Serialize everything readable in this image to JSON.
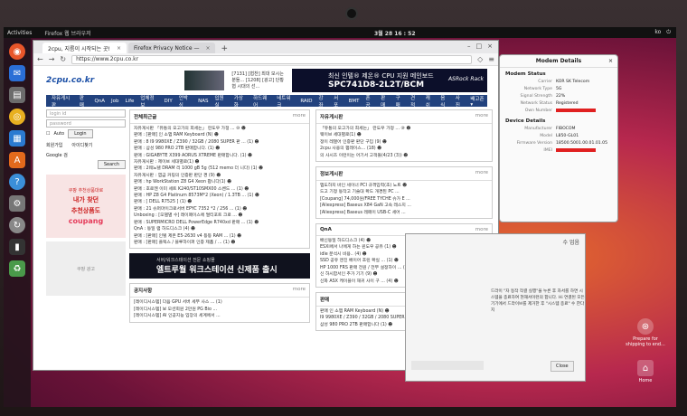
{
  "topbar": {
    "activities": "Activities",
    "app_menu": "Firefox 웹 브라우저",
    "clock": "3월 28 16 : 52",
    "tray": [
      "ko",
      "⏻"
    ]
  },
  "browser": {
    "tabs": [
      {
        "label": "2cpu, 지름이 시작되는 곳!"
      },
      {
        "label": "Firefox Privacy Notice —"
      }
    ],
    "new_tab": "+",
    "url": "https://www.2cpu.co.kr"
  },
  "site": {
    "logo": "2cpu.co.kr",
    "ad_text": "[7131] [협찬] 최대 모시는 분들... [1208] [광고] 단황협 시대의 선...",
    "ad2_line1": "최신 인텔® 제온® CPU 지원 메인보드",
    "ad2_line2": "SPC741D8-2L2T/BCM",
    "ad2_brand": "ASRock Rack",
    "menu": [
      "자유게시판",
      "판매",
      "QnA",
      "Job",
      "Life",
      "업체정보",
      "DIY",
      "언박싱",
      "NAS",
      "입원실",
      "가상화",
      "하드웨어",
      "네트워크",
      "RAID",
      "강좌",
      "서포",
      "BMT",
      "혼공",
      "판매",
      "구매",
      "견적",
      "캐쉬",
      "음식",
      "사진",
      "배고픈 ▾"
    ],
    "login_id": "login id",
    "password": "password",
    "auto": "Auto",
    "login_btn": "Login",
    "signup": "회원가입",
    "find_pw": "아이디찾기",
    "search_label": "Google 검",
    "search_btn": "Search",
    "side_ad_line1": "쿠팡 추천상품대로",
    "side_ad_line2": "내가 찾던",
    "side_ad_line3": "추천상품도",
    "side_ad_brand": "coupang",
    "side_ad2": "쿠팡 광고"
  },
  "sections": {
    "all_latest": {
      "title": "전체최근글",
      "more": "more",
      "items": [
        "자유게시판 「유통의 오고가의 희세는」 란도우 가정 ... ⑩ ☻",
        "판매 : [판매] 인 소앱 RAM Keyboard (N) ☻",
        "판매 : 8 I9 9980XE / Z390 / 32GB / 2080 SUPER 판 ... (1) ☻",
        "판매 : 삼성 980 PRO 2TB 판매합니다. (1) ☻",
        "판매 : GIGABYTE X399 AORUS XTREME 판매합니다. (1) ☻",
        "자유게시판 : 제이브 세대별로(1) ☻",
        "판매 : 2웨노텔 DRAM 리 1000 gB 5g (512 memo 더 니다) (1) ☻",
        "자유게시판 : 염금 커링의 인증판 판단 경 (9) ☻",
        "판매 : hp WorkStation Z8 G4 Xeon 팝니다(1) ☻",
        "판매 : 호로젠 이미 세트 K240/ST10SMX00 스벤드 ... (1) ☻",
        "판매 : HP Z8 G4 Platinum 8573M*2 (Xeon) / 1.3TB ... (1) ☻",
        "판매 : [ DELL R7525 ] (1) ☻",
        "판매 : 21 슈퍼마이크로서버 EPYC 7352 *2 / 256 ... (1) ☻",
        "Unboxing : [모델별 수] 레이페이스에 멀티포트 크로 ... ☻",
        "판매 : SUPERMICRO DELL PowerEdge R740xd 판매 ... (1) ☻",
        "QnA : 동일 램 하드디스크 (4) ☻",
        "판매 : [판매] 인텔 제온 E5-2630 v4 등등 RAM ... (1) ☻",
        "판매 : [판매] 플렉스 / 블루하이퍼 인증 제품 / ... (1) ☻"
      ]
    },
    "free_board": {
      "title": "자유게시판",
      "more": "more",
      "items": [
        "「유통의 오고가의 희세는」 란도우 가정 ... ⑩ ☻",
        "웨이브 세대별로(1) ☻",
        "정이 레열어 인증판 판단 구입 (9) ☻",
        "2cpu 사용의 펌레이스... (18) ☻",
        "의 사시즈 이런이는 어기서 고객들(4/23 (3)) ☻"
      ]
    },
    "info": {
      "title": "정보게시판",
      "more": "more",
      "items": [
        "앱도하지 바인 세이너 PCI 규격입력(초) 노트 ☻",
        "드고 기정 동작고 기술대 확드 개경된 PC ...",
        "[Coupang] 74,000원/FREE TYCHE 슈가 E ...",
        "[Aliexpress] Baseus X84 GaN 고속 레스지 ...",
        "[Aliexpress] Baseus 레페이 USB-C 세어 ..."
      ]
    },
    "qna": {
      "title": "QnA",
      "more": "more",
      "items": [
        "배신동일 하드디스크 (4) ☻",
        "ESXi에서 나에게 하는 윈도우 공유 (1) ☻",
        "idle 분석시 비용.. (4) ☻",
        "SSD 공유 엔진 베이어 호린 확실 ... (1) ☻",
        "HP 1000 FRS 판매 전원 / 전부 설정하이 ... (1) ☻",
        "신 하시합서인 추가 기기 (9) ☻",
        "신화 ASX 케이블이 재귀 사이 구 ... (4) ☻"
      ]
    },
    "notice": {
      "title": "공지사항",
      "more": "more",
      "items": [
        "[레이디시스템] 다음 GPU 서버 세부 사스 ... (1)",
        "[레이디시스템] 보 모션회원 2만원 PG Bio ...",
        "[레이디시스템] AI 인공지능 입장의 세계에서 ..."
      ]
    },
    "sale": {
      "title": "판매",
      "more": "more",
      "items": [
        "판매 인 소앱 RAM Keyboard (N) ☻",
        "I9 9980XE / Z390 / 32GB / 2080 SUPER 판 ... (1) ☻",
        "삼성 980 PRO 2TB 판매합니다 (1) ☻"
      ]
    }
  },
  "banner": {
    "line1": "서버/워크스테이션 전문 쇼핑몰",
    "line2": "엘트루월 워크스테이션 신제품 출시"
  },
  "modem": {
    "title": "Modem Details",
    "close": "×",
    "status_title": "Modem Status",
    "status": [
      {
        "k": "Carrier",
        "v": "KOR SK Telecom"
      },
      {
        "k": "Network Type",
        "v": "5G"
      },
      {
        "k": "Signal Strength",
        "v": "22%"
      },
      {
        "k": "Network Status",
        "v": "Registered"
      },
      {
        "k": "Own Number",
        "v": ""
      }
    ],
    "device_title": "Device Details",
    "device": [
      {
        "k": "Manufacturer",
        "v": "FIBOCOM"
      },
      {
        "k": "Model",
        "v": "L850-GL01"
      },
      {
        "k": "Firmware Version",
        "v": "18500.5001.00.01.01.05"
      },
      {
        "k": "IMEI",
        "v": ""
      }
    ]
  },
  "dialog": {
    "title": "수 업음",
    "message": "드라이 \"자 동작 작결 실행\"을 누른 후 자서를 하면 시스템을 종료하여 현재서이런의 합니다. Hi 연결된 모든 기기에서 드라이브를 제거한 후 \"시스템 종료\" 수 한다 지",
    "close": "Close"
  },
  "desktop": {
    "prepare": "Prepare for shipping to end...",
    "home": "Home"
  },
  "colors": {
    "menu_bg": "#22427e",
    "accent_red": "#e02020",
    "wallpaper": "#b7284e"
  }
}
